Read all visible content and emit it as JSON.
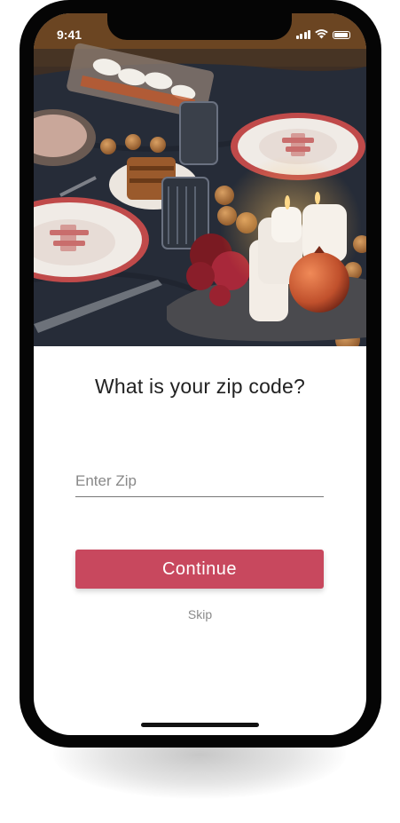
{
  "status_bar": {
    "time": "9:41"
  },
  "hero": {
    "image": "dinner-table-photo"
  },
  "prompt": {
    "title": "What is your zip code?"
  },
  "zip": {
    "placeholder": "Enter Zip",
    "value": ""
  },
  "actions": {
    "continue_label": "Continue",
    "skip_label": "Skip"
  },
  "colors": {
    "accent": "#c8485e"
  }
}
